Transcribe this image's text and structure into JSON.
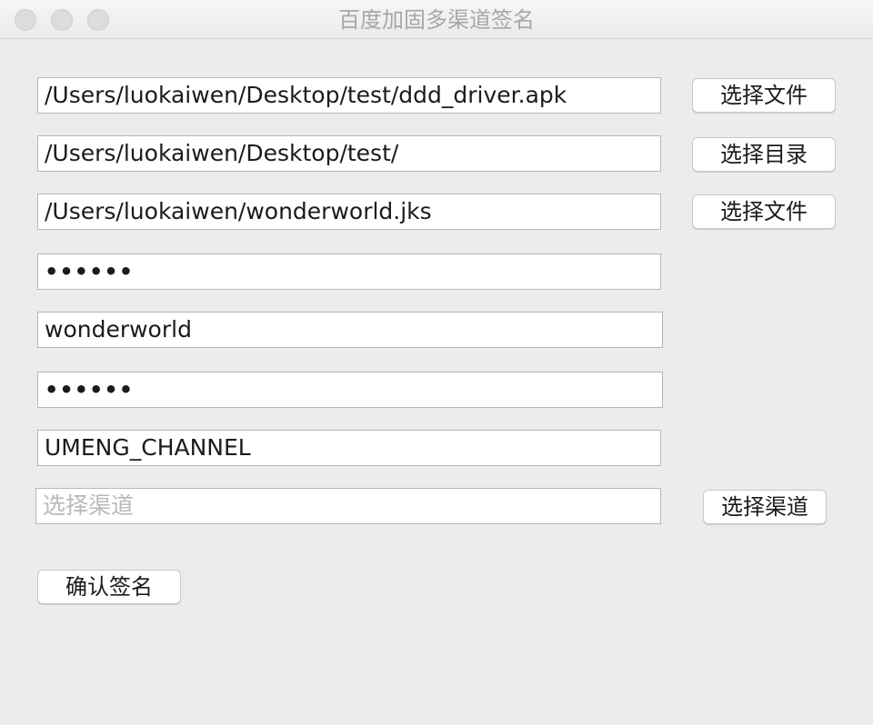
{
  "window": {
    "title": "百度加固多渠道签名"
  },
  "form": {
    "apk_path": "/Users/luokaiwen/Desktop/test/ddd_driver.apk",
    "output_dir": "/Users/luokaiwen/Desktop/test/",
    "keystore_path": "/Users/luokaiwen/wonderworld.jks",
    "keystore_password": "••••••",
    "alias": "wonderworld",
    "alias_password": "••••••",
    "channel_key": "UMENG_CHANNEL",
    "channel_placeholder": "选择渠道"
  },
  "buttons": {
    "select_file_1": "选择文件",
    "select_directory": "选择目录",
    "select_file_2": "选择文件",
    "select_channel": "选择渠道",
    "confirm_sign": "确认签名"
  }
}
